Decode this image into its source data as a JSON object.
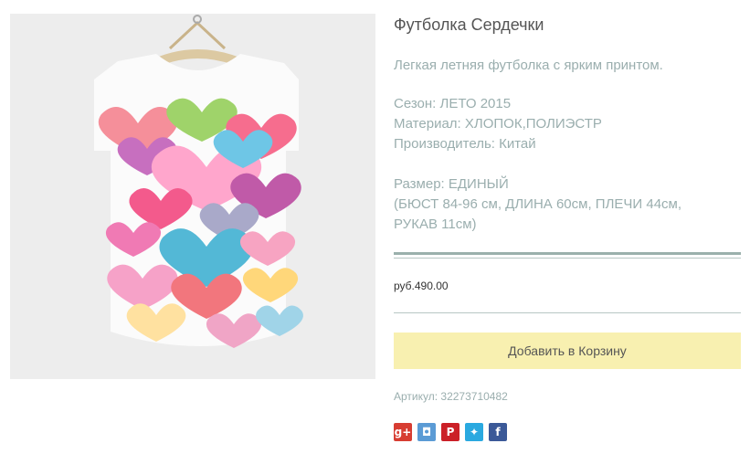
{
  "product": {
    "title": "Футболка Сердечки",
    "description": "Легкая летняя футболка с ярким принтом.",
    "season": "Сезон: ЛЕТО 2015",
    "material": "Материал: ХЛОПОК,ПОЛИЭСТР",
    "maker": "Производитель: Китай",
    "size": "Размер: ЕДИНЫЙ",
    "size_detail_1": "(БЮСТ 84-96 см, ДЛИНА 60см, ПЛЕЧИ 44см,",
    "size_detail_2": "РУКАВ 11см)",
    "price": "руб.490.00",
    "sku": "Артикул: 32273710482"
  },
  "actions": {
    "add_to_cart": "Добавить в Корзину"
  },
  "social": [
    {
      "icon": "google-plus-icon",
      "glyph": "g+",
      "color": "#d73d32"
    },
    {
      "icon": "vk-icon",
      "glyph": "◘",
      "color": "#5b9bd5"
    },
    {
      "icon": "pinterest-icon",
      "glyph": "P",
      "color": "#cb2027"
    },
    {
      "icon": "twitter-icon",
      "glyph": "✦",
      "color": "#2aa9e0"
    },
    {
      "icon": "facebook-icon",
      "glyph": "f",
      "color": "#3b5998"
    }
  ]
}
